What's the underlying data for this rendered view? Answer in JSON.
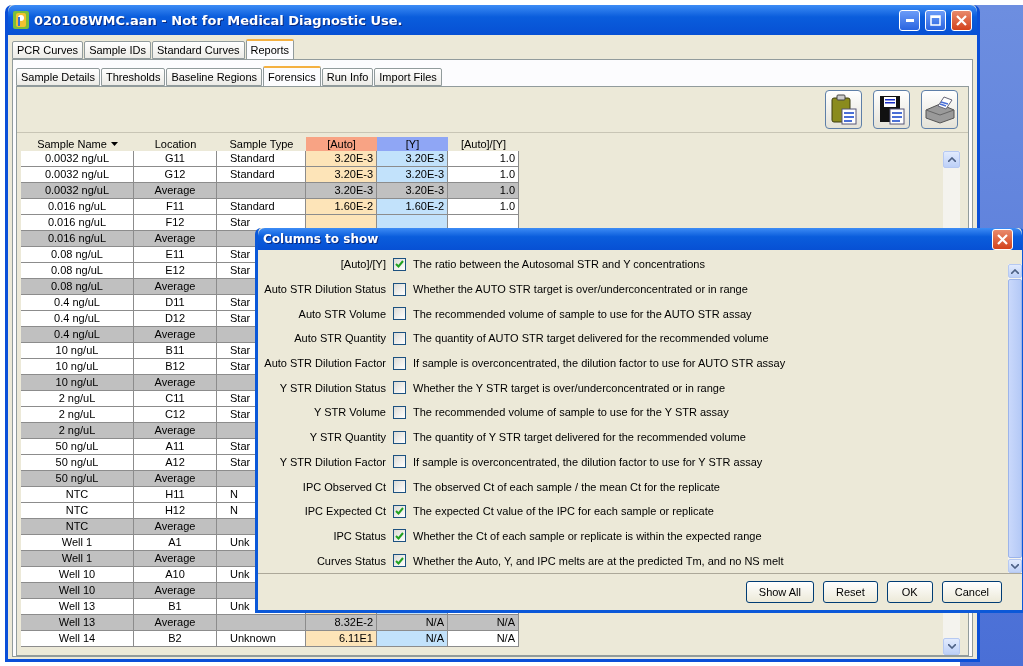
{
  "window": {
    "title": "020108WMC.aan - Not for Medical Diagnostic Use."
  },
  "tabs": [
    {
      "label": "PCR Curves",
      "selected": false
    },
    {
      "label": "Sample IDs",
      "selected": false
    },
    {
      "label": "Standard Curves",
      "selected": false
    },
    {
      "label": "Reports",
      "selected": true
    }
  ],
  "subtabs": [
    {
      "label": "Sample Details",
      "selected": false
    },
    {
      "label": "Thresholds",
      "selected": false
    },
    {
      "label": "Baseline Regions",
      "selected": false
    },
    {
      "label": "Forensics",
      "selected": true
    },
    {
      "label": "Run Info",
      "selected": false
    },
    {
      "label": "Import Files",
      "selected": false
    }
  ],
  "table": {
    "columns": [
      "Sample Name",
      "Location",
      "Sample Type",
      "[Auto]",
      "[Y]",
      "[Auto]/[Y]"
    ],
    "rows": [
      {
        "kind": "sample",
        "name": "0.0032 ng/uL",
        "location": "G11",
        "type": "Standard",
        "auto": "3.20E-3",
        "y": "3.20E-3",
        "ratio": "1.0"
      },
      {
        "kind": "sample",
        "name": "0.0032 ng/uL",
        "location": "G12",
        "type": "Standard",
        "auto": "3.20E-3",
        "y": "3.20E-3",
        "ratio": "1.0"
      },
      {
        "kind": "average",
        "name": "0.0032 ng/uL",
        "location": "Average",
        "auto": "3.20E-3",
        "y": "3.20E-3",
        "ratio": "1.0"
      },
      {
        "kind": "sample",
        "name": "0.016 ng/uL",
        "location": "F11",
        "type": "Standard",
        "auto": "1.60E-2",
        "y": "1.60E-2",
        "ratio": "1.0"
      },
      {
        "kind": "sample",
        "name": "0.016 ng/uL",
        "location": "F12",
        "type": "Star"
      },
      {
        "kind": "average",
        "name": "0.016 ng/uL",
        "location": "Average"
      },
      {
        "kind": "sample",
        "name": "0.08 ng/uL",
        "location": "E11",
        "type": "Star"
      },
      {
        "kind": "sample",
        "name": "0.08 ng/uL",
        "location": "E12",
        "type": "Star"
      },
      {
        "kind": "average",
        "name": "0.08 ng/uL",
        "location": "Average"
      },
      {
        "kind": "sample",
        "name": "0.4 ng/uL",
        "location": "D11",
        "type": "Star"
      },
      {
        "kind": "sample",
        "name": "0.4 ng/uL",
        "location": "D12",
        "type": "Star"
      },
      {
        "kind": "average",
        "name": "0.4 ng/uL",
        "location": "Average"
      },
      {
        "kind": "sample",
        "name": "10 ng/uL",
        "location": "B11",
        "type": "Star"
      },
      {
        "kind": "sample",
        "name": "10 ng/uL",
        "location": "B12",
        "type": "Star"
      },
      {
        "kind": "average",
        "name": "10 ng/uL",
        "location": "Average"
      },
      {
        "kind": "sample",
        "name": "2 ng/uL",
        "location": "C11",
        "type": "Star"
      },
      {
        "kind": "sample",
        "name": "2 ng/uL",
        "location": "C12",
        "type": "Star"
      },
      {
        "kind": "average",
        "name": "2 ng/uL",
        "location": "Average"
      },
      {
        "kind": "sample",
        "name": "50 ng/uL",
        "location": "A11",
        "type": "Star"
      },
      {
        "kind": "sample",
        "name": "50 ng/uL",
        "location": "A12",
        "type": "Star"
      },
      {
        "kind": "average",
        "name": "50 ng/uL",
        "location": "Average"
      },
      {
        "kind": "sample",
        "name": "NTC",
        "location": "H11",
        "type": "N"
      },
      {
        "kind": "sample",
        "name": "NTC",
        "location": "H12",
        "type": "N"
      },
      {
        "kind": "average",
        "name": "NTC",
        "location": "Average"
      },
      {
        "kind": "sample",
        "name": "Well 1",
        "location": "A1",
        "type": "Unk"
      },
      {
        "kind": "average",
        "name": "Well 1",
        "location": "Average"
      },
      {
        "kind": "sample",
        "name": "Well 10",
        "location": "A10",
        "type": "Unk"
      },
      {
        "kind": "average",
        "name": "Well 10",
        "location": "Average"
      },
      {
        "kind": "sample",
        "name": "Well 13",
        "location": "B1",
        "type": "Unk"
      },
      {
        "kind": "average",
        "name": "Well 13",
        "location": "Average",
        "auto": "8.32E-2",
        "y": "N/A",
        "ratio": "N/A"
      },
      {
        "kind": "sample",
        "name": "Well 14",
        "location": "B2",
        "type": "Unknown",
        "auto": "6.11E1",
        "y": "N/A",
        "ratio": "N/A"
      }
    ]
  },
  "dialog": {
    "title": "Columns to show",
    "options": [
      {
        "label": "[Auto]/[Y]",
        "description": "The ratio between the Autosomal STR and Y concentrations",
        "checked": true
      },
      {
        "label": "Auto STR Dilution Status",
        "description": "Whether the AUTO STR target is over/underconcentrated or in range",
        "checked": false
      },
      {
        "label": "Auto STR Volume",
        "description": "The recommended volume of sample to use for the AUTO STR assay",
        "checked": false
      },
      {
        "label": "Auto STR Quantity",
        "description": "The quantity of AUTO STR target delivered for the recommended volume",
        "checked": false
      },
      {
        "label": "Auto STR Dilution Factor",
        "description": "If sample is overconcentrated, the dilution factor to use for AUTO STR assay",
        "checked": false
      },
      {
        "label": "Y STR Dilution Status",
        "description": "Whether the Y STR target is over/underconcentrated or in range",
        "checked": false
      },
      {
        "label": "Y STR Volume",
        "description": "The recommended volume of sample to use for the Y STR assay",
        "checked": false
      },
      {
        "label": "Y STR Quantity",
        "description": "The quantity of Y STR target delivered for the recommended volume",
        "checked": false
      },
      {
        "label": "Y STR Dilution Factor",
        "description": "If sample is overconcentrated, the dilution factor to use for Y STR assay",
        "checked": false
      },
      {
        "label": "IPC Observed Ct",
        "description": "The observed Ct of each sample / the mean Ct for the replicate",
        "checked": false
      },
      {
        "label": "IPC Expected Ct",
        "description": "The expected Ct value of the IPC for each sample or replicate",
        "checked": true
      },
      {
        "label": "IPC Status",
        "description": "Whether the Ct of each sample or replicate is within the expected range",
        "checked": true
      },
      {
        "label": "Curves Status",
        "description": "Whether the Auto, Y, and IPC melts are at the predicted Tm, and no NS melt",
        "checked": true
      }
    ],
    "buttons": [
      "Show All",
      "Reset",
      "OK",
      "Cancel"
    ]
  }
}
